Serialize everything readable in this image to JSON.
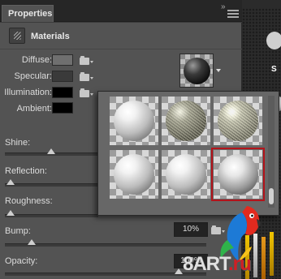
{
  "panel": {
    "tab_label": "Properties",
    "collapse_glyph": "»",
    "title": "Materials",
    "title_icon": "materials-icon"
  },
  "properties": [
    {
      "label": "Diffuse:",
      "color": "#6f6f6f"
    },
    {
      "label": "Specular:",
      "color": "#3a3a3a"
    },
    {
      "label": "Illumination:",
      "color": "#000000"
    },
    {
      "label": "Ambient:",
      "color": "#000000"
    }
  ],
  "sliders": [
    {
      "label": "Shine:",
      "value_fraction": 0.45
    },
    {
      "label": "Reflection:",
      "value_fraction": 0.0
    },
    {
      "label": "Roughness:",
      "value_fraction": 0.0
    },
    {
      "label": "Bump:",
      "value": "10%",
      "value_fraction": 0.1
    },
    {
      "label": "Opacity:",
      "value": "100%",
      "value_fraction": 1.0
    }
  ],
  "material_picker": {
    "rows": [
      [
        "white-sphere",
        "grain-sphere",
        "metal-sphere"
      ],
      [
        "white-sphere",
        "white-sphere",
        "shiny-sphere"
      ]
    ],
    "selected": "row-2-col-3"
  },
  "colors": {
    "panel_bg": "#535353",
    "tab_bar": "#262626",
    "selection_outline": "#b3141b"
  },
  "background": {
    "cut_text": "S"
  },
  "watermark": {
    "text_a": "8ART",
    "text_b": ".ru"
  }
}
